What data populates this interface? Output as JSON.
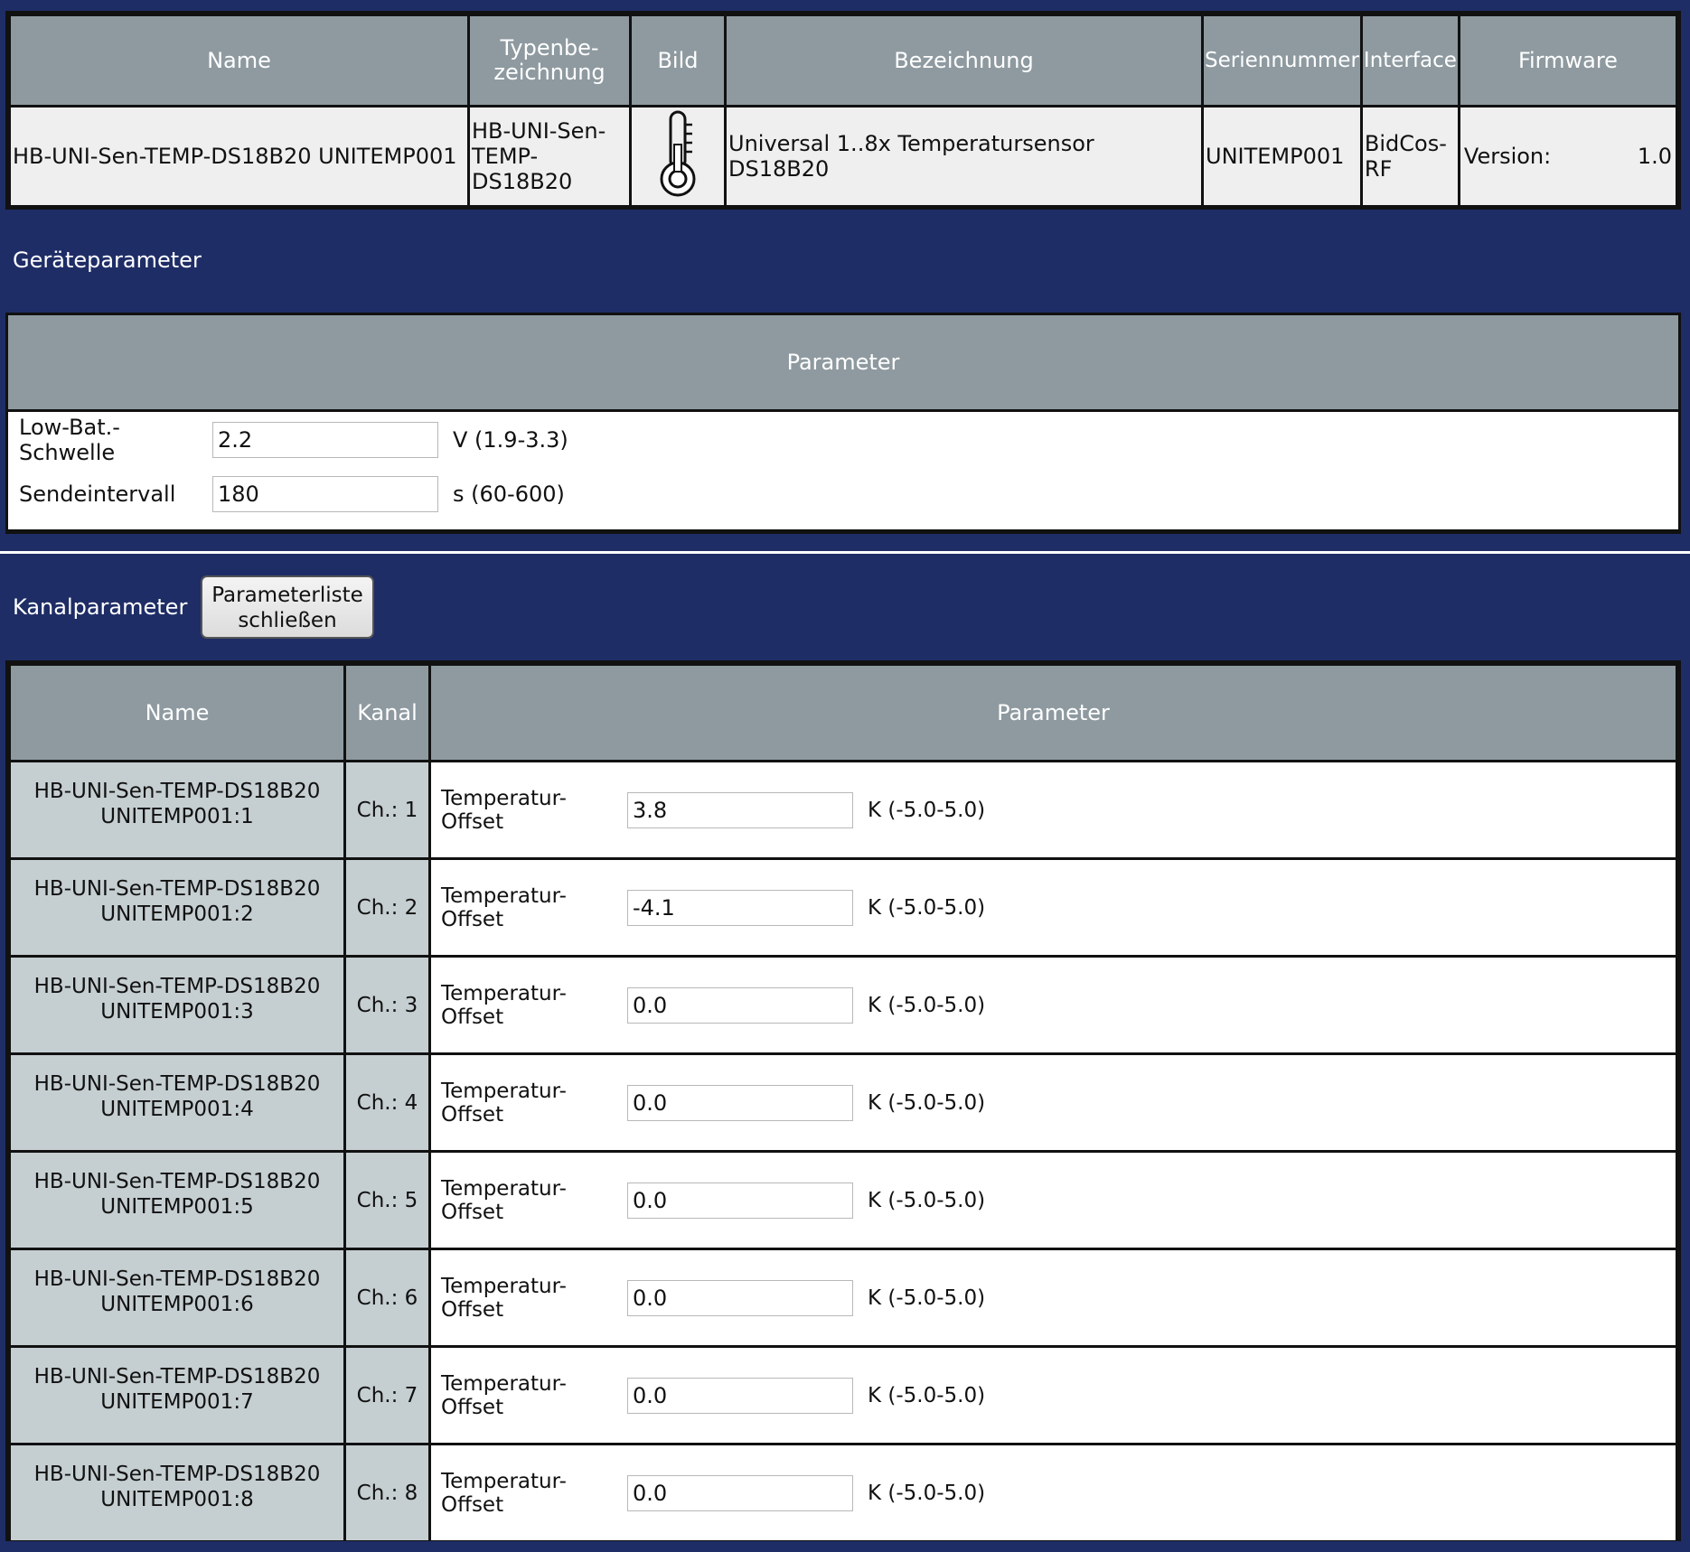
{
  "device_table": {
    "headers": {
      "name": "Name",
      "type": "Typenbe-\nzeichnung",
      "image": "Bild",
      "description": "Bezeichnung",
      "serial": "Seriennummer",
      "interface": "Interface",
      "firmware": "Firmware"
    },
    "row": {
      "name": "HB-UNI-Sen-TEMP-DS18B20 UNITEMP001",
      "type": "HB-UNI-Sen-\nTEMP-DS18B20",
      "image_icon": "thermometer-icon",
      "description": "Universal 1..8x Temperatursensor DS18B20",
      "serial": "UNITEMP001",
      "interface": "BidCos-\nRF",
      "firmware_label": "Version:",
      "firmware_value": "1.0"
    }
  },
  "device_params": {
    "section_title": "Geräteparameter",
    "header": "Parameter",
    "rows": [
      {
        "label": "Low-Bat.-Schwelle",
        "value": "2.2",
        "unit": "V (1.9-3.3)"
      },
      {
        "label": "Sendeintervall",
        "value": "180",
        "unit": "s (60-600)"
      }
    ]
  },
  "channel_params": {
    "section_title": "Kanalparameter",
    "close_button_label": "Parameterliste\nschließen",
    "headers": {
      "name": "Name",
      "channel": "Kanal",
      "parameter": "Parameter"
    },
    "rows": [
      {
        "name": "HB-UNI-Sen-TEMP-DS18B20\nUNITEMP001:1",
        "channel": "Ch.: 1",
        "param_label": "Temperatur-Offset",
        "value": "3.8",
        "unit": "K (-5.0-5.0)"
      },
      {
        "name": "HB-UNI-Sen-TEMP-DS18B20\nUNITEMP001:2",
        "channel": "Ch.: 2",
        "param_label": "Temperatur-Offset",
        "value": "-4.1",
        "unit": "K (-5.0-5.0)"
      },
      {
        "name": "HB-UNI-Sen-TEMP-DS18B20\nUNITEMP001:3",
        "channel": "Ch.: 3",
        "param_label": "Temperatur-Offset",
        "value": "0.0",
        "unit": "K (-5.0-5.0)"
      },
      {
        "name": "HB-UNI-Sen-TEMP-DS18B20\nUNITEMP001:4",
        "channel": "Ch.: 4",
        "param_label": "Temperatur-Offset",
        "value": "0.0",
        "unit": "K (-5.0-5.0)"
      },
      {
        "name": "HB-UNI-Sen-TEMP-DS18B20\nUNITEMP001:5",
        "channel": "Ch.: 5",
        "param_label": "Temperatur-Offset",
        "value": "0.0",
        "unit": "K (-5.0-5.0)"
      },
      {
        "name": "HB-UNI-Sen-TEMP-DS18B20\nUNITEMP001:6",
        "channel": "Ch.: 6",
        "param_label": "Temperatur-Offset",
        "value": "0.0",
        "unit": "K (-5.0-5.0)"
      },
      {
        "name": "HB-UNI-Sen-TEMP-DS18B20\nUNITEMP001:7",
        "channel": "Ch.: 7",
        "param_label": "Temperatur-Offset",
        "value": "0.0",
        "unit": "K (-5.0-5.0)"
      },
      {
        "name": "HB-UNI-Sen-TEMP-DS18B20\nUNITEMP001:8",
        "channel": "Ch.: 8",
        "param_label": "Temperatur-Offset",
        "value": "0.0",
        "unit": "K (-5.0-5.0)"
      }
    ]
  }
}
